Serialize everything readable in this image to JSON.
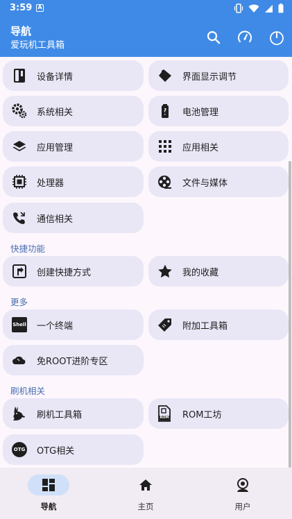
{
  "status_bar": {
    "time": "3:59",
    "notif_letter": "A",
    "icons": [
      "vibrate-icon",
      "wifi-icon",
      "signal-icon",
      "battery-icon"
    ]
  },
  "app_bar": {
    "title": "导航",
    "subtitle": "爱玩机工具箱",
    "actions": [
      "search-icon",
      "speedometer-icon",
      "power-icon"
    ]
  },
  "cards": {
    "device_details": "设备详情",
    "display_adjust": "界面显示调节",
    "system": "系统相关",
    "battery": "电池管理",
    "app_manage": "应用管理",
    "app_related": "应用相关",
    "processor": "处理器",
    "files_media": "文件与媒体",
    "telecom": "通信相关"
  },
  "sections": {
    "shortcuts": "快捷功能",
    "more": "更多",
    "flash": "刷机相关"
  },
  "shortcut_cards": {
    "create_shortcut": "创建快捷方式",
    "favorites": "我的收藏"
  },
  "more_cards": {
    "terminal": "一个终端",
    "extra_tools": "附加工具箱",
    "no_root": "免ROOT进阶专区"
  },
  "flash_cards": {
    "flash_tools": "刷机工具箱",
    "rom_workshop": "ROM工坊",
    "otg": "OTG相关"
  },
  "icon_text": {
    "shell": "Shell",
    "rom": "ROM",
    "otg": "OTG"
  },
  "bottom_nav": {
    "items": [
      "导航",
      "主页",
      "用户"
    ],
    "active_index": 0
  },
  "colors": {
    "primary": "#3f8ae6",
    "card": "#e9e7f6",
    "section": "#4a6fb0",
    "nav_pill": "#cfe0f8"
  }
}
